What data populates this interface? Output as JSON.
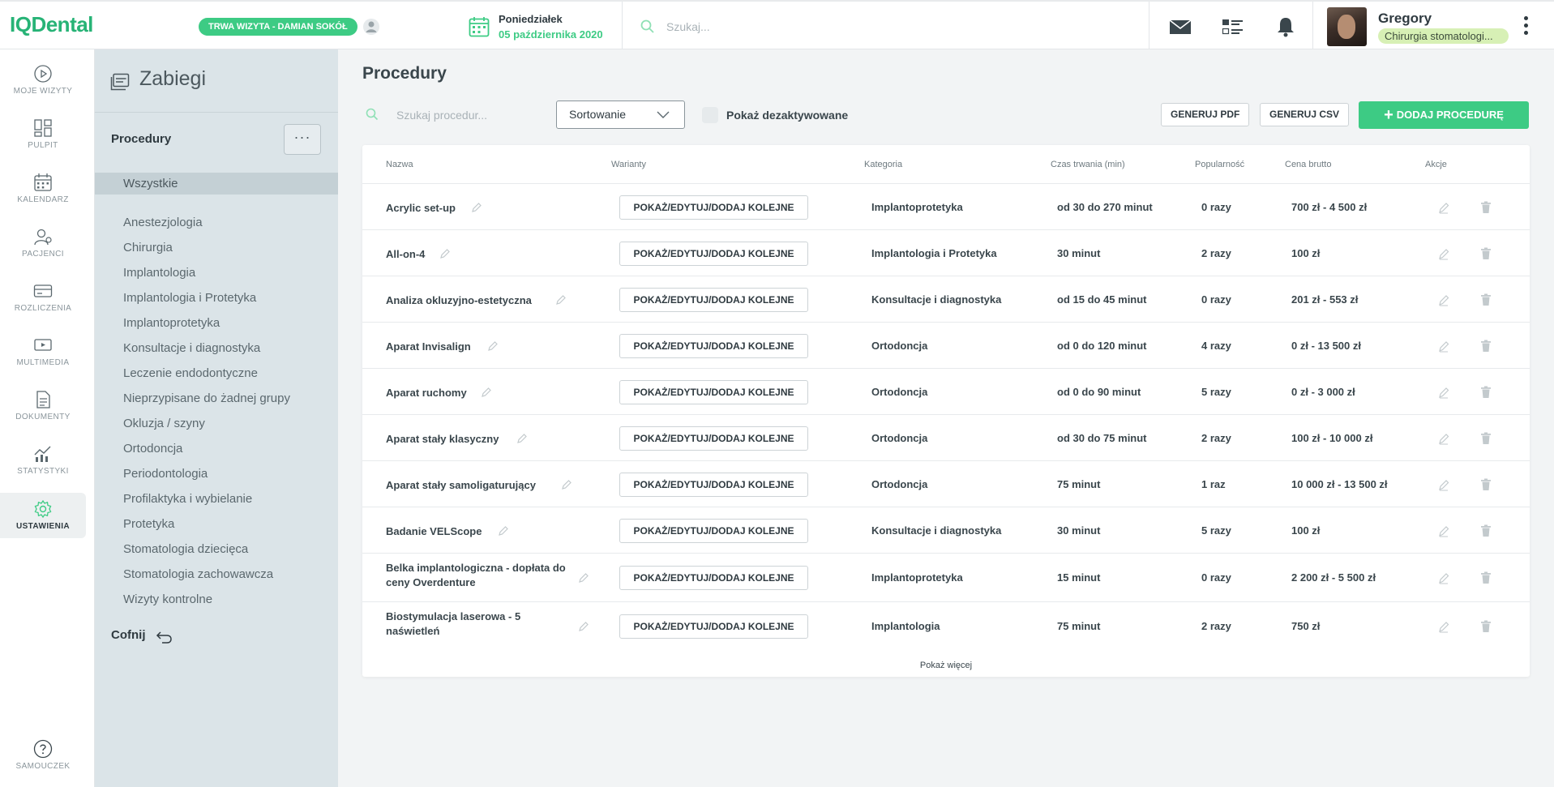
{
  "header": {
    "logo": "IQDental",
    "visit_badge": "TRWA WIZYTA - DAMIAN SOKÓŁ",
    "date_day": "Poniedziałek",
    "date_full": "05 października 2020",
    "search_placeholder": "Szukaj...",
    "user_name": "Gregory",
    "user_role": "Chirurgia stomatologi..."
  },
  "nav": {
    "items": [
      {
        "label": "MOJE WIZYTY",
        "icon": "play-circle-icon"
      },
      {
        "label": "PULPIT",
        "icon": "dashboard-icon"
      },
      {
        "label": "KALENDARZ",
        "icon": "calendar-icon"
      },
      {
        "label": "PACJENCI",
        "icon": "patients-icon"
      },
      {
        "label": "ROZLICZENIA",
        "icon": "card-icon"
      },
      {
        "label": "MULTIMEDIA",
        "icon": "media-icon"
      },
      {
        "label": "DOKUMENTY",
        "icon": "document-icon"
      },
      {
        "label": "STATYSTYKI",
        "icon": "stats-icon"
      },
      {
        "label": "USTAWIENIA",
        "icon": "gear-icon"
      }
    ],
    "help_label": "SAMOUCZEK"
  },
  "categories": {
    "title": "Zabiegi",
    "section_label": "Procedury",
    "more_label": "···",
    "all_label": "Wszystkie",
    "items": [
      "Anestezjologia",
      "Chirurgia",
      "Implantologia",
      "Implantologia i Protetyka",
      "Implantoprotetyka",
      "Konsultacje i diagnostyka",
      "Leczenie endodontyczne",
      "Nieprzypisane do żadnej grupy",
      "Okluzja / szyny",
      "Ortodoncja",
      "Periodontologia",
      "Profilaktyka i wybielanie",
      "Protetyka",
      "Stomatologia dziecięca",
      "Stomatologia zachowawcza",
      "Wizyty kontrolne"
    ],
    "back_label": "Cofnij"
  },
  "main": {
    "title": "Procedury",
    "search_placeholder": "Szukaj procedur...",
    "sort_label": "Sortowanie",
    "show_deactivated_label": "Pokaż dezaktywowane",
    "pdf_label": "GENERUJ PDF",
    "csv_label": "GENERUJ CSV",
    "add_label": "DODAJ PROCEDURĘ",
    "columns": [
      "Nazwa",
      "Warianty",
      "Kategoria",
      "Czas trwania (min)",
      "Popularność",
      "Cena brutto",
      "Akcje"
    ],
    "variant_button": "POKAŻ/EDYTUJ/DODAJ KOLEJNE",
    "rows": [
      {
        "name": "Acrylic set-up",
        "category": "Implantoprotetyka",
        "duration": "od 30 do 270 minut",
        "popularity": "0 razy",
        "price": "700 zł - 4 500 zł"
      },
      {
        "name": "All-on-4",
        "category": "Implantologia i Protetyka",
        "duration": "30 minut",
        "popularity": "2 razy",
        "price": "100 zł"
      },
      {
        "name": "Analiza okluzyjno-estetyczna",
        "category": "Konsultacje i diagnostyka",
        "duration": "od 15 do 45 minut",
        "popularity": "0 razy",
        "price": "201 zł - 553 zł"
      },
      {
        "name": "Aparat Invisalign",
        "category": "Ortodoncja",
        "duration": "od 0 do 120 minut",
        "popularity": "4 razy",
        "price": "0 zł - 13 500 zł"
      },
      {
        "name": "Aparat ruchomy",
        "category": "Ortodoncja",
        "duration": "od 0 do 90 minut",
        "popularity": "5 razy",
        "price": "0 zł - 3 000 zł"
      },
      {
        "name": "Aparat stały klasyczny",
        "category": "Ortodoncja",
        "duration": "od 30 do 75 minut",
        "popularity": "2 razy",
        "price": "100 zł - 10 000 zł"
      },
      {
        "name": "Aparat stały samoligaturujący",
        "category": "Ortodoncja",
        "duration": "75 minut",
        "popularity": "1 raz",
        "price": "10 000 zł - 13 500 zł"
      },
      {
        "name": "Badanie VELScope",
        "category": "Konsultacje i diagnostyka",
        "duration": "30 minut",
        "popularity": "5 razy",
        "price": "100 zł"
      },
      {
        "name": "Belka implantologiczna - dopłata do ceny Overdenture",
        "category": "Implantoprotetyka",
        "duration": "15 minut",
        "popularity": "0 razy",
        "price": "2 200 zł - 5 500 zł"
      },
      {
        "name": "Biostymulacja laserowa - 5 naświetleń",
        "category": "Implantologia",
        "duration": "75 minut",
        "popularity": "2 razy",
        "price": "750 zł"
      }
    ],
    "show_more": "Pokaż więcej"
  },
  "colors": {
    "accent": "#3dcb84",
    "logo": "#27b376",
    "panel": "#dbe4e8",
    "role_badge": "#d7f0b5"
  }
}
